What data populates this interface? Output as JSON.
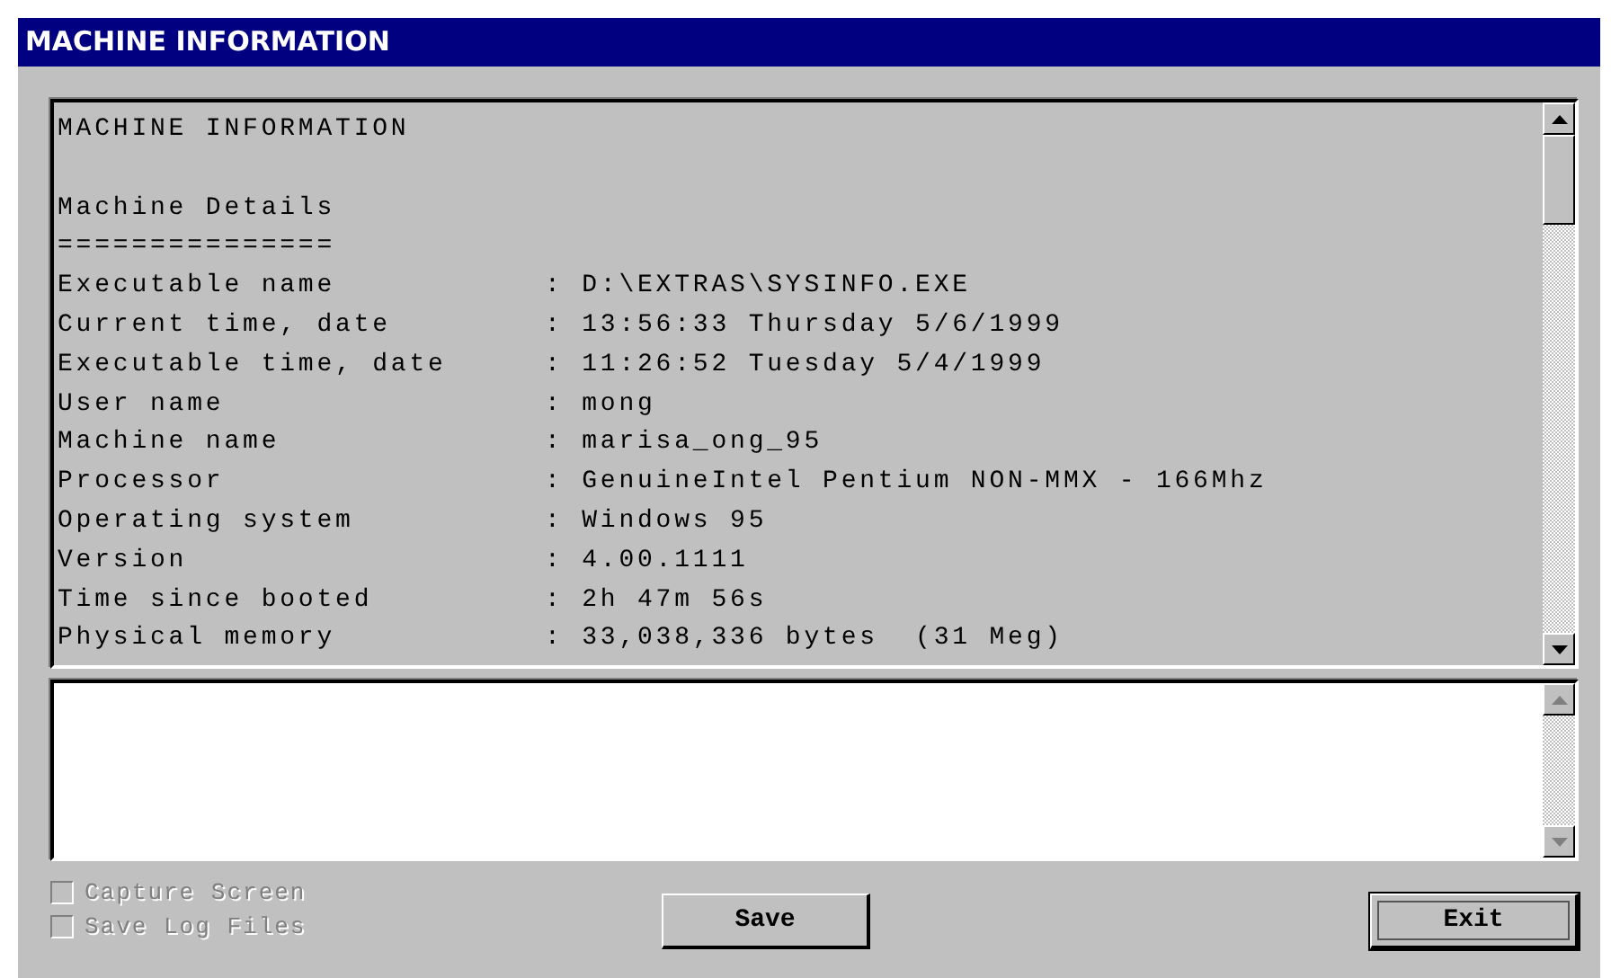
{
  "window": {
    "title": "MACHINE INFORMATION"
  },
  "log": {
    "lines": [
      {
        "kind": "text",
        "text": "MACHINE INFORMATION"
      },
      {
        "kind": "blank"
      },
      {
        "kind": "text",
        "text": "Machine Details"
      },
      {
        "kind": "text",
        "text": "==============="
      },
      {
        "kind": "field",
        "label": "Executable name",
        "value": ": D:\\EXTRAS\\SYSINFO.EXE"
      },
      {
        "kind": "field",
        "label": "Current time, date",
        "value": ": 13:56:33 Thursday 5/6/1999"
      },
      {
        "kind": "field",
        "label": "Executable time, date",
        "value": ": 11:26:52 Tuesday 5/4/1999"
      },
      {
        "kind": "field",
        "label": "User name",
        "value": ": mong"
      },
      {
        "kind": "field",
        "label": "Machine name",
        "value": ": marisa_ong_95"
      },
      {
        "kind": "field",
        "label": "Processor",
        "value": ": GenuineIntel Pentium NON-MMX - 166Mhz"
      },
      {
        "kind": "field",
        "label": "Operating system",
        "value": ": Windows 95"
      },
      {
        "kind": "field",
        "label": "Version",
        "value": ": 4.00.1111"
      },
      {
        "kind": "field",
        "label": "Time since booted",
        "value": ": 2h 47m 56s"
      },
      {
        "kind": "field",
        "label": "Physical memory",
        "value": ": 33,038,336 bytes  (31 Meg)"
      }
    ]
  },
  "options": [
    {
      "label": "Capture Screen",
      "checked": false,
      "disabled": true
    },
    {
      "label": "Save Log Files",
      "checked": false,
      "disabled": true
    }
  ],
  "buttons": [
    {
      "label": "Save",
      "focused": false
    },
    {
      "label": "Exit",
      "focused": true
    }
  ]
}
